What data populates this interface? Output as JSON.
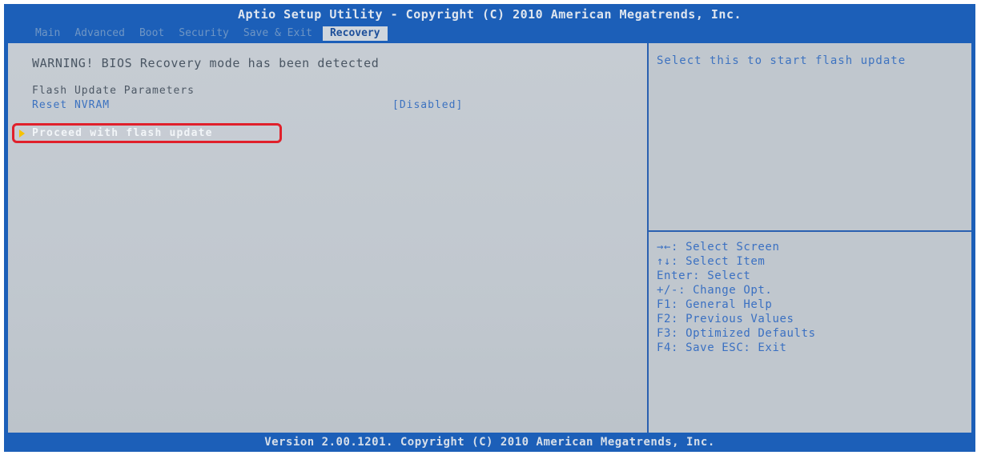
{
  "header": {
    "title": "Aptio Setup Utility - Copyright (C) 2010 American Megatrends, Inc."
  },
  "tabs": [
    {
      "label": "Main"
    },
    {
      "label": "Advanced"
    },
    {
      "label": "Boot"
    },
    {
      "label": "Security"
    },
    {
      "label": "Save & Exit"
    },
    {
      "label": "Recovery",
      "active": true
    }
  ],
  "main": {
    "warning": "WARNING! BIOS Recovery mode has been detected",
    "section_title": "Flash Update Parameters",
    "setting": {
      "label": "Reset NVRAM",
      "value": "[Disabled]"
    },
    "proceed_label": "Proceed with flash update"
  },
  "help": {
    "text": "Select this to start flash update"
  },
  "keys": [
    "→←: Select Screen",
    "↑↓: Select Item",
    "Enter: Select",
    "+/-: Change Opt.",
    "F1: General Help",
    "F2: Previous Values",
    "F3: Optimized Defaults",
    "F4: Save  ESC: Exit"
  ],
  "footer": {
    "text": "Version 2.00.1201. Copyright (C) 2010 American Megatrends, Inc."
  },
  "colors": {
    "frame_blue": "#1c5fb8",
    "panel_gray": "#c3cad1",
    "highlight_red": "#e0202b",
    "arrow_yellow": "#f6c200"
  }
}
